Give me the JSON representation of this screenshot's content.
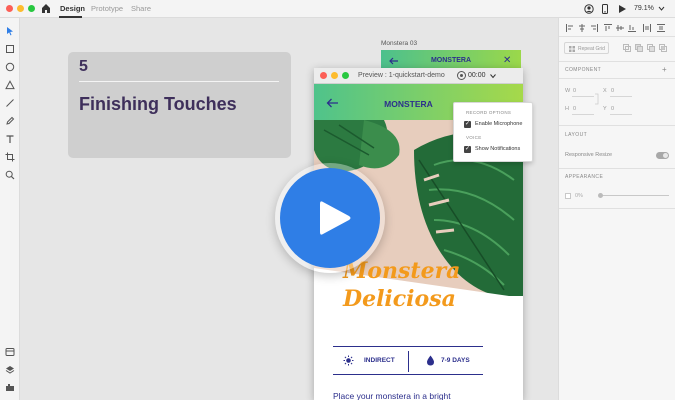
{
  "titlebar": {
    "tabs": [
      {
        "label": "Design",
        "active": true
      },
      {
        "label": "Prototype",
        "active": false
      },
      {
        "label": "Share",
        "active": false
      }
    ],
    "zoom": "79.1%",
    "icons": [
      "home-icon",
      "user-icon",
      "mobile-preview-icon",
      "play-icon"
    ]
  },
  "toolbar": {
    "tools": [
      "select-tool",
      "rectangle-tool",
      "ellipse-tool",
      "triangle-tool",
      "line-tool",
      "pen-tool",
      "text-tool",
      "artboard-tool",
      "zoom-tool"
    ],
    "bottom_tools": [
      "assets-icon",
      "layers-icon",
      "plugins-icon"
    ]
  },
  "canvas": {
    "card": {
      "number": "5",
      "title": "Finishing Touches"
    },
    "artboard": {
      "label": "Monstera 03",
      "header_title": "MONSTERA",
      "close": "✕"
    }
  },
  "preview": {
    "title": "Preview : 1-quickstart-demo",
    "timer": "00:00",
    "header_title": "MONSTERA",
    "back": "←",
    "plant_name_line1": "Monstera",
    "plant_name_line2": "Deliciosa",
    "light": "INDIRECT",
    "water": "7-9 DAYS",
    "description": "Place your monstera in a bright"
  },
  "record_menu": {
    "heading_record": "RECORD OPTIONS",
    "enable_microphone": "Enable Microphone",
    "heading_voice": "VOICE",
    "show_notifications": "Show Notifications"
  },
  "right_panel": {
    "repeat_grid": "Repeat Grid",
    "component_heading": "COMPONENT",
    "add": "+",
    "w_label": "W",
    "w_value": "0",
    "x_label": "X",
    "x_value": "0",
    "h_label": "H",
    "h_value": "0",
    "y_label": "Y",
    "y_value": "0",
    "layout_heading": "LAYOUT",
    "responsive_resize": "Responsive Resize",
    "appearance_heading": "APPEARANCE",
    "opacity": "0%"
  },
  "colors": {
    "accent_blue": "#2f7ee6",
    "brand_navy": "#2c2f8c",
    "brand_orange": "#f39a1c",
    "header_green": "#4fc38b",
    "title_purple": "#3e2f5b"
  }
}
